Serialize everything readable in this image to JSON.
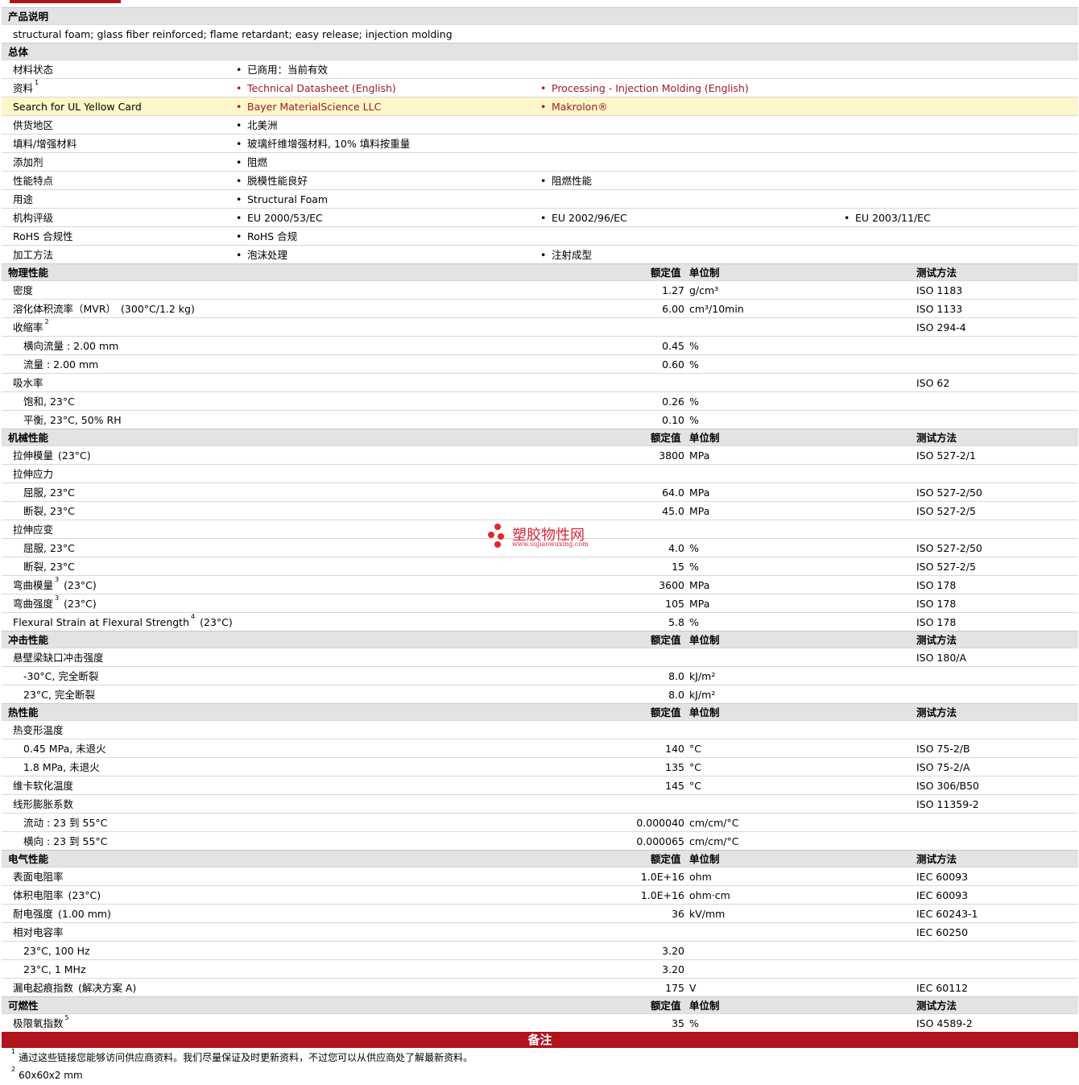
{
  "watermark": {
    "title": "塑胶物性网",
    "url": "www.sujiaowuxing.com"
  },
  "product_description": {
    "title": "产品说明",
    "text": "structural foam; glass fiber reinforced; flame retardant; easy release; injection molding"
  },
  "general": {
    "title": "总体",
    "rows": [
      {
        "label": "材料状态",
        "sup": "",
        "items": [
          {
            "text": "已商用：当前有效",
            "link": false
          }
        ]
      },
      {
        "label": "资料",
        "sup": "1",
        "items": [
          {
            "text": "Technical Datasheet (English)",
            "link": true
          },
          {
            "text": "Processing - Injection Molding (English)",
            "link": true
          }
        ]
      },
      {
        "label": "Search for UL Yellow Card",
        "sup": "",
        "highlight": true,
        "items": [
          {
            "text": "Bayer MaterialScience LLC",
            "link": true
          },
          {
            "text": "Makrolon®",
            "link": true
          }
        ]
      },
      {
        "label": "供货地区",
        "sup": "",
        "items": [
          {
            "text": "北美洲",
            "link": false
          }
        ]
      },
      {
        "label": "填料/增强材料",
        "sup": "",
        "items": [
          {
            "text": "玻璃纤维增强材料, 10% 填料按重量",
            "link": false
          }
        ]
      },
      {
        "label": "添加剂",
        "sup": "",
        "items": [
          {
            "text": "阻燃",
            "link": false
          }
        ]
      },
      {
        "label": "性能特点",
        "sup": "",
        "items": [
          {
            "text": "脱模性能良好",
            "link": false
          },
          {
            "text": "阻燃性能",
            "link": false
          }
        ]
      },
      {
        "label": "用途",
        "sup": "",
        "items": [
          {
            "text": "Structural Foam",
            "link": false
          }
        ]
      },
      {
        "label": "机构评级",
        "sup": "",
        "items": [
          {
            "text": "EU 2000/53/EC",
            "link": false
          },
          {
            "text": "EU 2002/96/EC",
            "link": false
          },
          {
            "text": "EU 2003/11/EC",
            "link": false
          }
        ]
      },
      {
        "label": "RoHS 合规性",
        "sup": "",
        "items": [
          {
            "text": "RoHS 合规",
            "link": false
          }
        ]
      },
      {
        "label": "加工方法",
        "sup": "",
        "items": [
          {
            "text": "泡沫处理",
            "link": false
          },
          {
            "text": "注射成型",
            "link": false
          }
        ]
      }
    ]
  },
  "headers": {
    "value": "额定值",
    "unit": "单位制",
    "method": "测试方法"
  },
  "sections": [
    {
      "title": "物理性能",
      "rows": [
        {
          "label": "密度",
          "sup": "",
          "suffix": "",
          "indent": false,
          "value": "1.27",
          "unit": "g/cm³",
          "method": "ISO 1183"
        },
        {
          "label": "溶化体积流率（MVR）",
          "sup": "",
          "suffix": "(300°C/1.2 kg)",
          "indent": false,
          "value": "6.00",
          "unit": "cm³/10min",
          "method": "ISO 1133"
        },
        {
          "label": "收缩率",
          "sup": "2",
          "suffix": "",
          "indent": false,
          "value": "",
          "unit": "",
          "method": "ISO 294-4"
        },
        {
          "label": "横向流量 : 2.00 mm",
          "sup": "",
          "suffix": "",
          "indent": true,
          "value": "0.45",
          "unit": "%",
          "method": ""
        },
        {
          "label": "流量 : 2.00 mm",
          "sup": "",
          "suffix": "",
          "indent": true,
          "value": "0.60",
          "unit": "%",
          "method": ""
        },
        {
          "label": "吸水率",
          "sup": "",
          "suffix": "",
          "indent": false,
          "value": "",
          "unit": "",
          "method": "ISO 62"
        },
        {
          "label": "饱和, 23°C",
          "sup": "",
          "suffix": "",
          "indent": true,
          "value": "0.26",
          "unit": "%",
          "method": ""
        },
        {
          "label": "平衡, 23°C, 50% RH",
          "sup": "",
          "suffix": "",
          "indent": true,
          "value": "0.10",
          "unit": "%",
          "method": ""
        }
      ]
    },
    {
      "title": "机械性能",
      "rows": [
        {
          "label": "拉伸模量",
          "sup": "",
          "suffix": "(23°C)",
          "indent": false,
          "value": "3800",
          "unit": "MPa",
          "method": "ISO 527-2/1"
        },
        {
          "label": "拉伸应力",
          "sup": "",
          "suffix": "",
          "indent": false,
          "value": "",
          "unit": "",
          "method": ""
        },
        {
          "label": "屈服, 23°C",
          "sup": "",
          "suffix": "",
          "indent": true,
          "value": "64.0",
          "unit": "MPa",
          "method": "ISO 527-2/50"
        },
        {
          "label": "断裂, 23°C",
          "sup": "",
          "suffix": "",
          "indent": true,
          "value": "45.0",
          "unit": "MPa",
          "method": "ISO 527-2/5"
        },
        {
          "label": "拉伸应变",
          "sup": "",
          "suffix": "",
          "indent": false,
          "value": "",
          "unit": "",
          "method": ""
        },
        {
          "label": "屈服, 23°C",
          "sup": "",
          "suffix": "",
          "indent": true,
          "value": "4.0",
          "unit": "%",
          "method": "ISO 527-2/50"
        },
        {
          "label": "断裂, 23°C",
          "sup": "",
          "suffix": "",
          "indent": true,
          "value": "15",
          "unit": "%",
          "method": "ISO 527-2/5"
        },
        {
          "label": "弯曲模量",
          "sup": "3",
          "suffix": "(23°C)",
          "indent": false,
          "value": "3600",
          "unit": "MPa",
          "method": "ISO 178"
        },
        {
          "label": "弯曲强度",
          "sup": "3",
          "suffix": "(23°C)",
          "indent": false,
          "value": "105",
          "unit": "MPa",
          "method": "ISO 178"
        },
        {
          "label": "Flexural Strain at Flexural Strength",
          "sup": "4",
          "suffix": "(23°C)",
          "indent": false,
          "value": "5.8",
          "unit": "%",
          "method": "ISO 178"
        }
      ]
    },
    {
      "title": "冲击性能",
      "rows": [
        {
          "label": "悬壁梁缺口冲击强度",
          "sup": "",
          "suffix": "",
          "indent": false,
          "value": "",
          "unit": "",
          "method": "ISO 180/A"
        },
        {
          "label": "-30°C, 完全断裂",
          "sup": "",
          "suffix": "",
          "indent": true,
          "value": "8.0",
          "unit": "kJ/m²",
          "method": ""
        },
        {
          "label": "23°C, 完全断裂",
          "sup": "",
          "suffix": "",
          "indent": true,
          "value": "8.0",
          "unit": "kJ/m²",
          "method": ""
        }
      ]
    },
    {
      "title": "热性能",
      "rows": [
        {
          "label": "热变形温度",
          "sup": "",
          "suffix": "",
          "indent": false,
          "value": "",
          "unit": "",
          "method": ""
        },
        {
          "label": "0.45 MPa, 未退火",
          "sup": "",
          "suffix": "",
          "indent": true,
          "value": "140",
          "unit": "°C",
          "method": "ISO 75-2/B"
        },
        {
          "label": "1.8 MPa, 未退火",
          "sup": "",
          "suffix": "",
          "indent": true,
          "value": "135",
          "unit": "°C",
          "method": "ISO 75-2/A"
        },
        {
          "label": "维卡软化温度",
          "sup": "",
          "suffix": "",
          "indent": false,
          "value": "145",
          "unit": "°C",
          "method": "ISO 306/B50"
        },
        {
          "label": "线形膨胀系数",
          "sup": "",
          "suffix": "",
          "indent": false,
          "value": "",
          "unit": "",
          "method": "ISO 11359-2"
        },
        {
          "label": "流动 : 23 到 55°C",
          "sup": "",
          "suffix": "",
          "indent": true,
          "value": "0.000040",
          "unit": "cm/cm/°C",
          "method": ""
        },
        {
          "label": "横向 : 23 到 55°C",
          "sup": "",
          "suffix": "",
          "indent": true,
          "value": "0.000065",
          "unit": "cm/cm/°C",
          "method": ""
        }
      ]
    },
    {
      "title": "电气性能",
      "rows": [
        {
          "label": "表面电阻率",
          "sup": "",
          "suffix": "",
          "indent": false,
          "value": "1.0E+16",
          "unit": "ohm",
          "method": "IEC 60093"
        },
        {
          "label": "体积电阻率",
          "sup": "",
          "suffix": "(23°C)",
          "indent": false,
          "value": "1.0E+16",
          "unit": "ohm·cm",
          "method": "IEC 60093"
        },
        {
          "label": "耐电强度",
          "sup": "",
          "suffix": "(1.00 mm)",
          "indent": false,
          "value": "36",
          "unit": "kV/mm",
          "method": "IEC 60243-1"
        },
        {
          "label": "相对电容率",
          "sup": "",
          "suffix": "",
          "indent": false,
          "value": "",
          "unit": "",
          "method": "IEC 60250"
        },
        {
          "label": "23°C, 100 Hz",
          "sup": "",
          "suffix": "",
          "indent": true,
          "value": "3.20",
          "unit": "",
          "method": ""
        },
        {
          "label": "23°C, 1 MHz",
          "sup": "",
          "suffix": "",
          "indent": true,
          "value": "3.20",
          "unit": "",
          "method": ""
        },
        {
          "label": "漏电起痕指数",
          "sup": "",
          "suffix": "(解决方案 A)",
          "indent": false,
          "value": "175",
          "unit": "V",
          "method": "IEC 60112"
        }
      ]
    },
    {
      "title": "可燃性",
      "rows": [
        {
          "label": "极限氧指数",
          "sup": "5",
          "suffix": "",
          "indent": false,
          "value": "35",
          "unit": "%",
          "method": "ISO 4589-2"
        }
      ]
    }
  ],
  "notes": {
    "title": "备注",
    "footnotes": [
      {
        "num": "1",
        "text": "通过这些链接您能够访问供应商资料。我们尽量保证及时更新资料，不过您可以从供应商处了解最新资料。"
      },
      {
        "num": "2",
        "text": "60x60x2 mm"
      }
    ]
  },
  "colors": {
    "accent": "#b0141c",
    "link": "#9c1a2b",
    "section_bg": "#e3e3e3",
    "highlight_bg": "#fdf6c9"
  }
}
